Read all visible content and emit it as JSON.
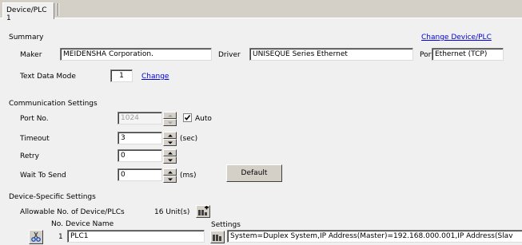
{
  "tab": {
    "label": "Device/PLC 1"
  },
  "summary": {
    "heading": "Summary",
    "change_link": "Change Device/PLC",
    "maker_label": "Maker",
    "maker_value": "MEIDENSHA Corporation.",
    "driver_label": "Driver",
    "driver_value": "UNISEQUE Series Ethernet",
    "port_label": "Port",
    "port_value": "Ethernet (TCP)",
    "text_mode_label": "Text Data Mode",
    "text_mode_value": "1",
    "text_mode_link": "Change"
  },
  "comm": {
    "heading": "Communication Settings",
    "port_label": "Port No.",
    "port_value": "1024",
    "auto_label": "Auto",
    "auto_checked": true,
    "timeout_label": "Timeout",
    "timeout_value": "3",
    "timeout_unit": "(sec)",
    "retry_label": "Retry",
    "retry_value": "0",
    "wait_label": "Wait To Send",
    "wait_value": "0",
    "wait_unit": "(ms)",
    "default_button": "Default"
  },
  "device": {
    "heading": "Device-Specific Settings",
    "allowable_label": "Allowable No. of Device/PLCs",
    "allowable_value": "16 Unit(s)",
    "col_no": "No.",
    "col_name": "Device Name",
    "col_settings": "Settings",
    "rows": [
      {
        "no": "1",
        "name": "PLC1",
        "settings": "System=Duplex System,IP Address(Master)=192.168.000.001,IP Address(Slav"
      }
    ]
  }
}
